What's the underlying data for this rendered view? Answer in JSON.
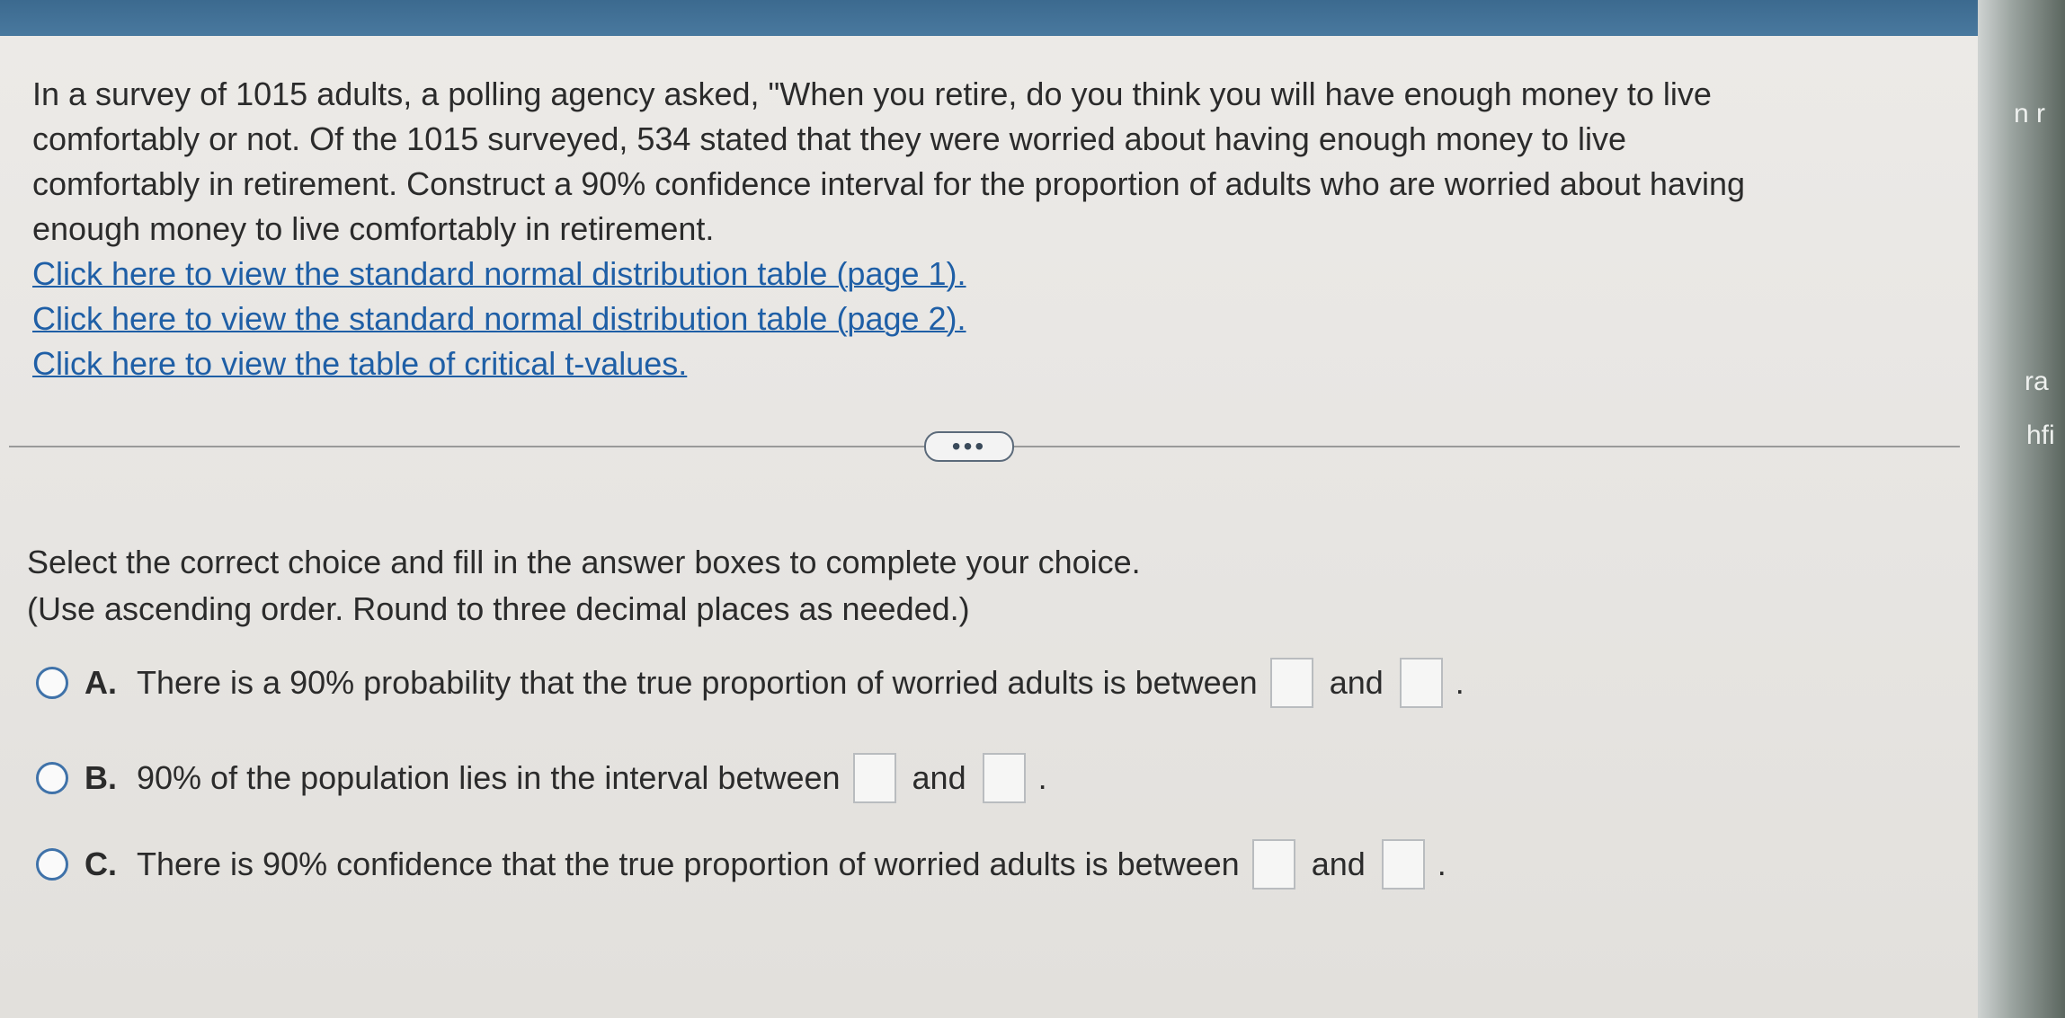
{
  "question": {
    "text_lines": [
      "In a survey of 1015 adults, a polling agency asked, \"When you retire, do you think you will have enough money to live",
      "comfortably or not. Of the 1015 surveyed, 534 stated that they were worried about having enough money to live",
      "comfortably in retirement. Construct a 90% confidence interval for the proportion of adults who are worried about having",
      "enough money to live comfortably in retirement."
    ],
    "links": [
      "Click here to view the standard normal distribution table (page 1).",
      "Click here to view the standard normal distribution table (page 2).",
      "Click here to view the table of critical t-values."
    ]
  },
  "more_button": "•••",
  "instructions": {
    "line1": "Select the correct choice and fill in the answer boxes to complete your choice.",
    "line2": "(Use ascending order. Round to three decimal places as needed.)"
  },
  "choices": [
    {
      "letter": "A.",
      "text": "There is a 90% probability that the true proportion of worried adults is between",
      "joiner": "and",
      "end": "."
    },
    {
      "letter": "B.",
      "text": "90% of the population lies in the interval between",
      "joiner": "and",
      "end": "."
    },
    {
      "letter": "C.",
      "text": "There is 90% confidence that the true proportion of worried adults is between",
      "joiner": "and",
      "end": "."
    }
  ],
  "side_fragments": [
    "n r",
    "ra",
    "hfi"
  ],
  "colors": {
    "link": "#1f5fa6",
    "radio_border": "#3f72a9",
    "top_bar": "#4a7aa0"
  }
}
